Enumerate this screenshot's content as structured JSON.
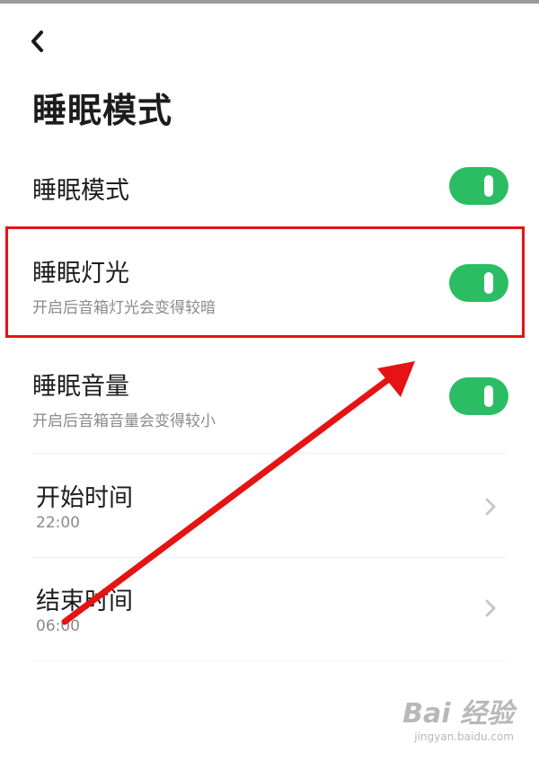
{
  "header": {
    "back_icon": "chevron-left-icon"
  },
  "title": "睡眠模式",
  "rows": {
    "sleep_mode": {
      "title": "睡眠模式",
      "toggle": true
    },
    "sleep_light": {
      "title": "睡眠灯光",
      "subtitle": "开启后音箱灯光会变得较暗",
      "toggle": true
    },
    "sleep_volume": {
      "title": "睡眠音量",
      "subtitle": "开启后音箱音量会变得较小",
      "toggle": true
    },
    "start_time": {
      "title": "开始时间",
      "value": "22:00"
    },
    "end_time": {
      "title": "结束时间",
      "value": "06:00"
    }
  },
  "colors": {
    "toggle_on": "#2bbd63",
    "highlight": "#e51313"
  },
  "watermark": {
    "logo": "Bai 经验",
    "url": "jingyan.baidu.com"
  }
}
